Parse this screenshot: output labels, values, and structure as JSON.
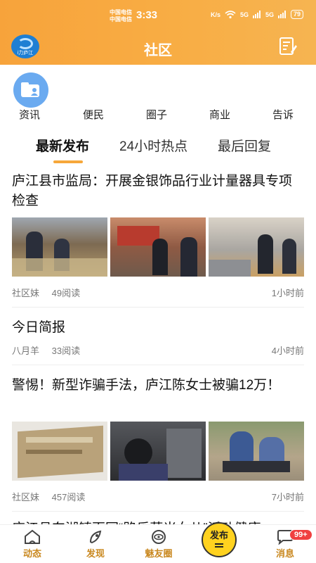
{
  "status_bar": {
    "carrier_1": "中国电信",
    "carrier_2": "中国电信",
    "time": "3:33",
    "network": "K/s",
    "signal_1": "5G",
    "signal_2": "5G",
    "battery": "79"
  },
  "header": {
    "logo_text": "i力庐江",
    "title": "社区"
  },
  "categories": [
    "资讯",
    "便民",
    "圈子",
    "商业",
    "告诉"
  ],
  "tabs": [
    {
      "label": "最新发布",
      "active": true
    },
    {
      "label": "24小时热点",
      "active": false
    },
    {
      "label": "最后回复",
      "active": false
    }
  ],
  "posts": [
    {
      "title": "庐江县市监局：开展金银饰品行业计量器具专项检查",
      "author": "社区妹",
      "reads": "49阅读",
      "time": "1小时前",
      "image_colors": [
        "#8b7a5a",
        "#a76b4b",
        "#9a9da0"
      ]
    },
    {
      "title": "今日简报",
      "author": "八月羊",
      "reads": "33阅读",
      "time": "4小时前"
    },
    {
      "title": "警惕！新型诈骗手法，庐江陈女士被骗12万！",
      "author": "社区妹",
      "reads": "457阅读",
      "time": "7小时前",
      "image_colors": [
        "#b9a27a",
        "#3b3b3d",
        "#8e9a7c"
      ]
    },
    {
      "title": "庐江县东湖镇百园“路乐茵米女儿”活动健康"
    }
  ],
  "bottom_nav": [
    {
      "label": "动态",
      "icon": "home-icon"
    },
    {
      "label": "发现",
      "icon": "rocket-icon"
    },
    {
      "label": "魅友圈",
      "icon": "circle-eye-icon"
    },
    {
      "label": "发布",
      "icon": "publish-icon"
    },
    {
      "label": "消息",
      "icon": "message-icon"
    }
  ],
  "messages_badge": "99+",
  "colors": {
    "header": "#f8ad44",
    "accent": "#f6a73a",
    "nav_text": "#c9881f",
    "publish_button": "#ffd21f",
    "badge": "#f04040"
  }
}
